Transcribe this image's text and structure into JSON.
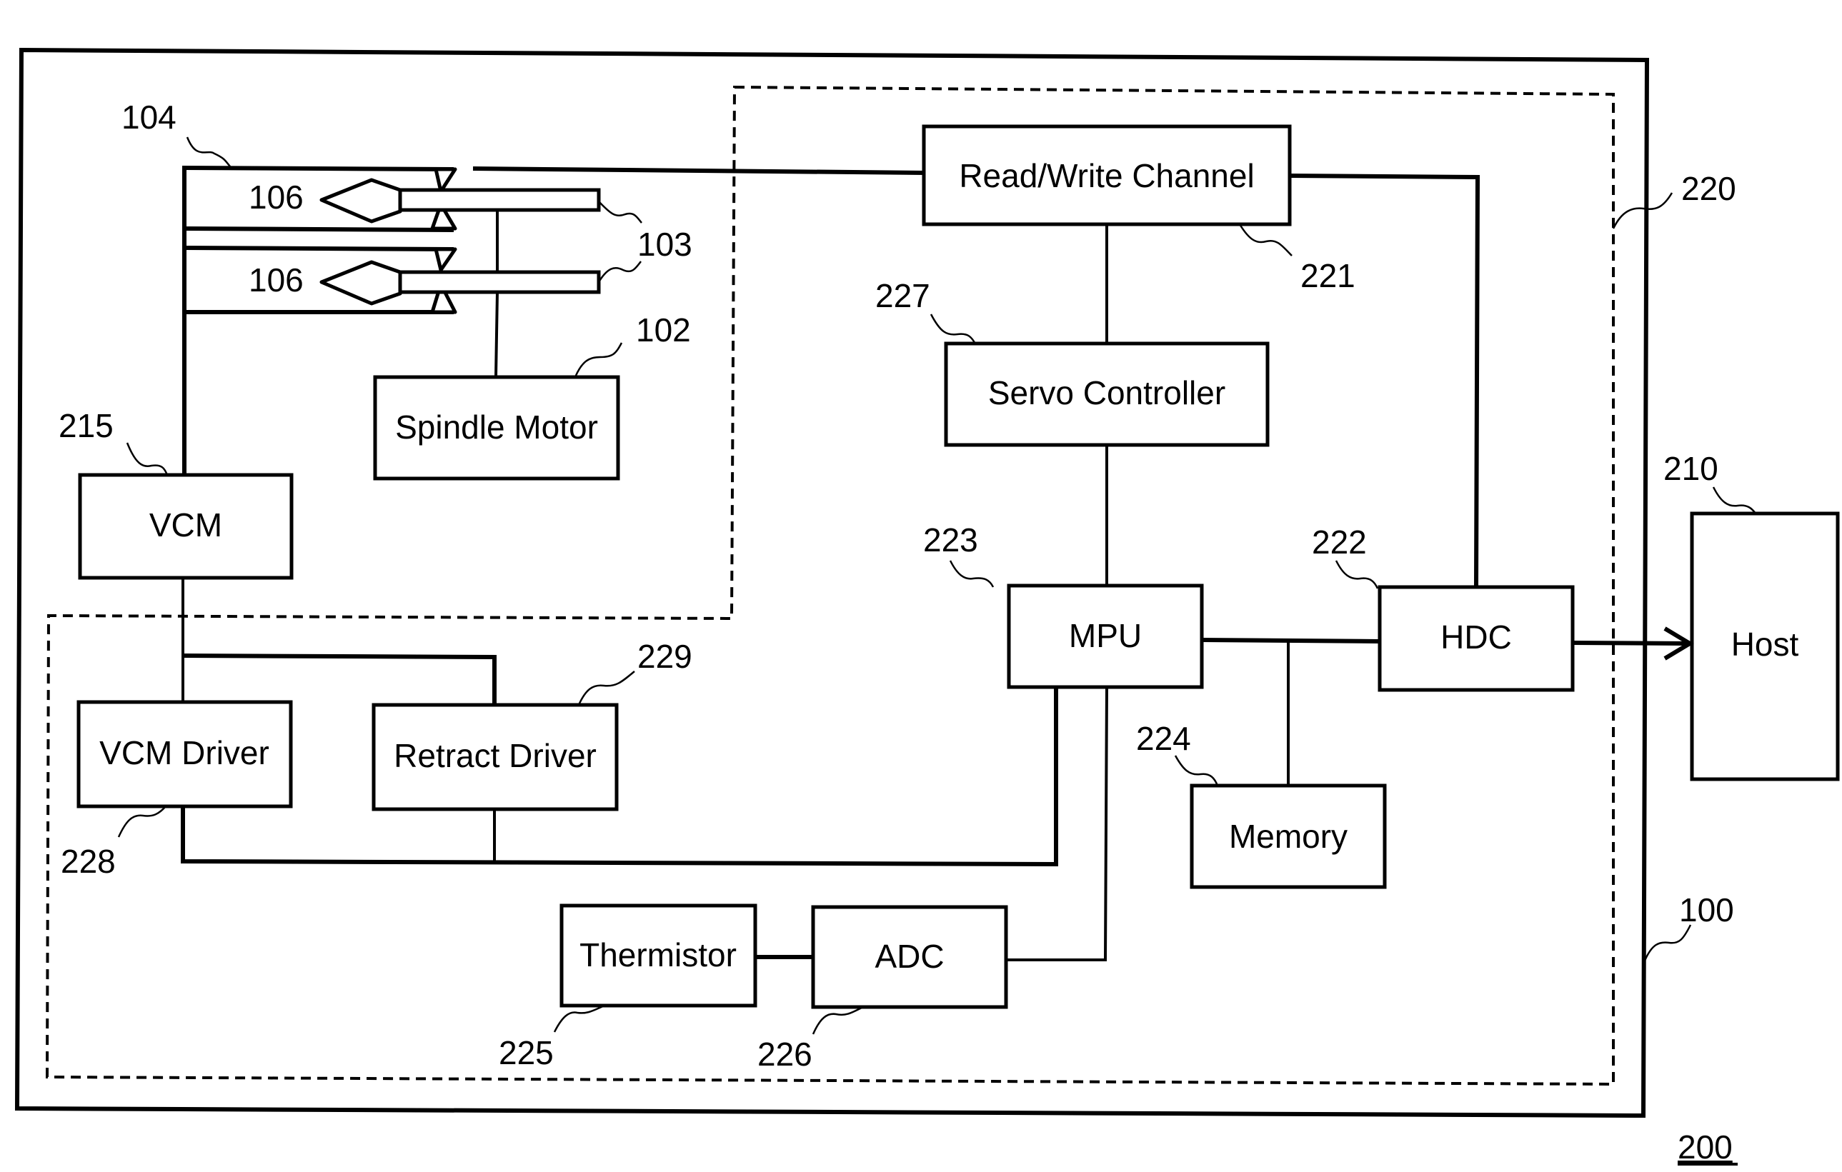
{
  "figure_label": "200",
  "blocks": {
    "rw_channel": "Read/Write Channel",
    "servo_controller": "Servo Controller",
    "spindle_motor": "Spindle Motor",
    "vcm": "VCM",
    "vcm_driver": "VCM Driver",
    "retract_driver": "Retract Driver",
    "mpu": "MPU",
    "hdc": "HDC",
    "memory": "Memory",
    "thermistor": "Thermistor",
    "adc": "ADC",
    "host": "Host"
  },
  "refs": {
    "r104": "104",
    "r106a": "106",
    "r106b": "106",
    "r103": "103",
    "r102": "102",
    "r215": "215",
    "r221": "221",
    "r227": "227",
    "r220": "220",
    "r223": "223",
    "r222": "222",
    "r210": "210",
    "r224": "224",
    "r229": "229",
    "r228": "228",
    "r225": "225",
    "r226": "226",
    "r100": "100"
  },
  "connections": [
    [
      "Read/Write Channel",
      "Servo Controller"
    ],
    [
      "Read/Write Channel",
      "HDC"
    ],
    [
      "Read/Write Channel",
      "Head 106"
    ],
    [
      "Servo Controller",
      "MPU"
    ],
    [
      "MPU",
      "HDC"
    ],
    [
      "MPU",
      "Memory"
    ],
    [
      "MPU",
      "ADC"
    ],
    [
      "MPU",
      "VCM Driver / Retract Driver"
    ],
    [
      "Thermistor",
      "ADC"
    ],
    [
      "VCM",
      "VCM Driver"
    ],
    [
      "VCM",
      "Retract Driver"
    ],
    [
      "VCM",
      "Actuator arm 104"
    ],
    [
      "Spindle Motor",
      "Disks 103"
    ],
    [
      "HDC",
      "Host"
    ]
  ]
}
